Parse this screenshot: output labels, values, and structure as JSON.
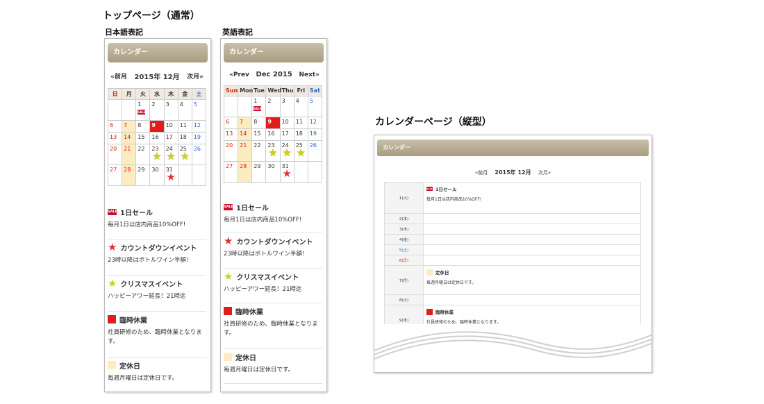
{
  "headings": {
    "top_page": "トップページ（通常）",
    "japanese": "日本語表記",
    "english": "英語表記",
    "calendar_page": "カレンダーページ（縦型）"
  },
  "ja": {
    "header": "カレンダー",
    "prev": "«前月",
    "month": "2015年 12月",
    "next": "次月»",
    "weekdays": [
      "日",
      "月",
      "火",
      "水",
      "木",
      "金",
      "土"
    ]
  },
  "en": {
    "header": "カレンダー",
    "prev": "«Prev",
    "month": "Dec 2015",
    "next": "Next»",
    "weekdays": [
      "Sun",
      "Mon",
      "Tue",
      "Wed",
      "Thu",
      "Fri",
      "Sat"
    ]
  },
  "weeks": [
    [
      "",
      "",
      "1",
      "2",
      "3",
      "4",
      "5"
    ],
    [
      "6",
      "7",
      "8",
      "9",
      "10",
      "11",
      "12"
    ],
    [
      "13",
      "14",
      "15",
      "16",
      "17",
      "18",
      "19"
    ],
    [
      "20",
      "21",
      "22",
      "23",
      "24",
      "25",
      "26"
    ],
    [
      "27",
      "28",
      "29",
      "30",
      "31",
      "",
      ""
    ]
  ],
  "marks": {
    "sale": [
      "1"
    ],
    "temporary_closure": [
      "9"
    ],
    "regular_holiday": [
      "7",
      "14",
      "21",
      "28"
    ],
    "christmas_star": [
      "23",
      "24",
      "25"
    ],
    "countdown_star": [
      "31"
    ]
  },
  "colors": {
    "header_gradient_top": "#c9bfa8",
    "header_gradient_bottom": "#a89c80",
    "temp_closure": "#e21b1b",
    "regular_holiday": "#fdecc2",
    "sunday": "#cc2200",
    "saturday": "#2266cc"
  },
  "legend": [
    {
      "icon": "sale-badge-icon",
      "title": "1日セール",
      "desc": "毎月1日は店内商品10%OFF!"
    },
    {
      "icon": "red-star-icon",
      "title": "カウントダウンイベント",
      "desc": "23時以降はボトルワイン半額！"
    },
    {
      "icon": "yellow-star-icon",
      "title": "クリスマスイベント",
      "desc": "ハッピーアワー延長！21時迄"
    },
    {
      "icon": "red-square-icon",
      "title": "臨時休業",
      "desc": "社員研修のため、臨時休業となります。"
    },
    {
      "icon": "cream-square-icon",
      "title": "定休日",
      "desc": "毎週月曜日は定休日です。"
    }
  ],
  "sale_badge": "SALE",
  "vertical": {
    "header": "カレンダー",
    "prev": "«前月",
    "month": "2015年 12月",
    "next": "次月»",
    "days": [
      {
        "label": "1(火)",
        "type": "normal",
        "icon": "sale",
        "title": "1日セール",
        "desc": "毎月1日は店内商品10%OFF!"
      },
      {
        "label": "2(水)",
        "type": "normal"
      },
      {
        "label": "3(木)",
        "type": "normal"
      },
      {
        "label": "4(金)",
        "type": "normal"
      },
      {
        "label": "5(土)",
        "type": "sat"
      },
      {
        "label": "6(日)",
        "type": "sun"
      },
      {
        "label": "7(月)",
        "type": "normal",
        "icon": "cream",
        "title": "定休日",
        "desc": "毎週月曜日は定休日です。"
      },
      {
        "label": "8(火)",
        "type": "normal"
      },
      {
        "label": "9(水)",
        "type": "normal",
        "icon": "red",
        "title": "臨時休業",
        "desc": "社員研修のため、臨時休業となります。"
      }
    ]
  }
}
